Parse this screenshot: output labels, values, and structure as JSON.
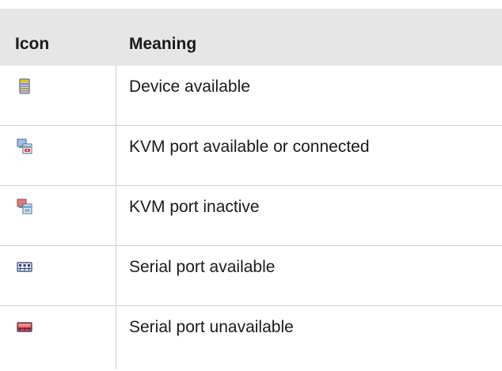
{
  "header": {
    "icon_col": "Icon",
    "meaning_col": "Meaning"
  },
  "rows": [
    {
      "icon": "device-available-icon",
      "meaning": "Device available"
    },
    {
      "icon": "kvm-port-available-icon",
      "meaning": "KVM port available or connected"
    },
    {
      "icon": "kvm-port-inactive-icon",
      "meaning": "KVM port inactive"
    },
    {
      "icon": "serial-port-available-icon",
      "meaning": "Serial port available"
    },
    {
      "icon": "serial-port-unavailable-icon",
      "meaning": "Serial port unavailable"
    }
  ]
}
